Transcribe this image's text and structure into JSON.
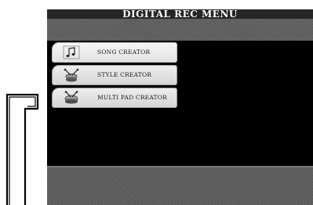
{
  "window": {
    "title": "DIGITAL REC MENU"
  },
  "menu": {
    "items": [
      {
        "label": "SONG CREATOR",
        "icon": "music-note-icon",
        "selected": true
      },
      {
        "label": "STYLE CREATOR",
        "icon": "style-drum-icon",
        "selected": false
      },
      {
        "label": "MULTI PAD CREATOR",
        "icon": "multipad-drum-icon",
        "selected": false
      }
    ]
  },
  "colors": {
    "title_bar": "#262626",
    "panel_band": "#5d5d5d",
    "button_face": "#dcdcdc",
    "screen_bg": "#000000"
  }
}
